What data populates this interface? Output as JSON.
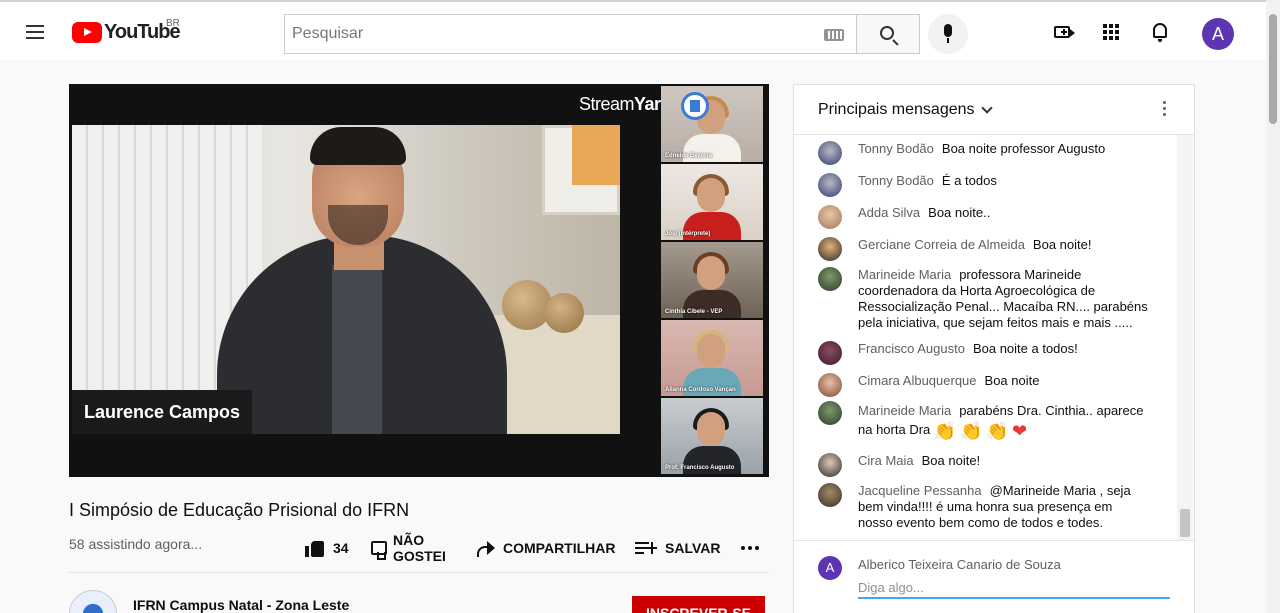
{
  "header": {
    "logo_text": "YouTube",
    "region": "BR",
    "search_placeholder": "Pesquisar",
    "avatar_letter": "A",
    "icons": [
      "menu-icon",
      "keyboard-icon",
      "search-icon",
      "mic-icon",
      "create-video-icon",
      "apps-icon",
      "bell-icon"
    ]
  },
  "player": {
    "brand_a": "Stream",
    "brand_b": "Yard",
    "presenter_name": "Laurence Campos",
    "tiles": [
      {
        "caption": "Edneide Bezerra"
      },
      {
        "caption": "Josi (intérprete)"
      },
      {
        "caption": "Cinthia Cibele - VEP"
      },
      {
        "caption": "Alianna Cordoso Vançan"
      },
      {
        "caption": "Prof. Francisco Augusto"
      }
    ]
  },
  "video": {
    "title": "I Simpósio de Educação Prisional do IFRN",
    "views": "58 assistindo agora...",
    "like_count": "34",
    "dislike_label_1": "NÃO",
    "dislike_label_2": "GOSTEI",
    "share_label": "COMPARTILHAR",
    "save_label": "SALVAR"
  },
  "channel": {
    "name": "IFRN Campus Natal - Zona Leste",
    "subscribe_label": "INSCREVER-SE"
  },
  "chat": {
    "mode_label": "Principais mensagens",
    "messages": [
      {
        "author": "Tonny Bodão",
        "text": "Boa noite professor Augusto"
      },
      {
        "author": "Tonny Bodão",
        "text": "É a todos"
      },
      {
        "author": "Adda Silva",
        "text": "Boa noite.."
      },
      {
        "author": "Gerciane Correia de Almeida",
        "text": "Boa noite!"
      },
      {
        "author": "Marineide Maria",
        "text": "professora Marineide coordenadora da Horta Agroecológica de Ressocialização Penal... Macaíba RN.... parabéns pela iniciativa, que sejam feitos mais e mais ....."
      },
      {
        "author": "Francisco Augusto",
        "text": "Boa noite a todos!"
      },
      {
        "author": "Cimara Albuquerque",
        "text": "Boa noite"
      },
      {
        "author": "Marineide Maria",
        "text": "parabéns Dra. Cinthia.. aparece na horta Dra",
        "emojis": [
          "👏",
          "👏",
          "👏",
          "❤"
        ]
      },
      {
        "author": "Cira Maia",
        "text": "Boa noite!"
      },
      {
        "author": "Jacqueline Pessanha",
        "text": "@Marineide Maria , seja bem vinda!!!! é uma honra sua presença em nosso evento bem como de todos e todes."
      }
    ],
    "me_name": "Alberico Teixeira Canario de Souza",
    "me_letter": "A",
    "input_placeholder": "Diga algo..."
  }
}
